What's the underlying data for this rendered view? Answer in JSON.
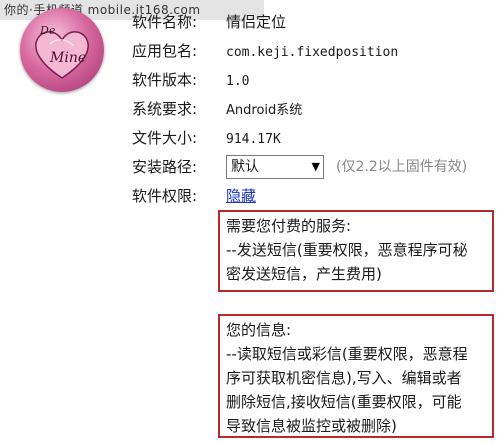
{
  "watermark": "你的·手机频道 mobile.it168.com",
  "icon": {
    "name": "heart-mine-icon",
    "text_top": "De",
    "text_main": "Mine"
  },
  "rows": {
    "name": {
      "label": "软件名称:",
      "value": "情侣定位"
    },
    "package": {
      "label": "应用包名:",
      "value": "com.keji.fixedposition"
    },
    "version": {
      "label": "软件版本:",
      "value": "1.0"
    },
    "requirement": {
      "label": "系统要求:",
      "value": "Android系统"
    },
    "size": {
      "label": "文件大小:",
      "value": "914.17K"
    },
    "install": {
      "label": "安装路径:",
      "selected": "默认",
      "hint": "(仅2.2以上固件有效)"
    },
    "permission": {
      "label": "软件权限:",
      "link": "隐藏"
    }
  },
  "paid_services": {
    "title": "需要您付费的服务:",
    "lines": [
      "--发送短信(重要权限，恶意程序可秘",
      "密发送短信，产生费用)"
    ]
  },
  "info": {
    "title": "您的信息:",
    "lines": [
      "--读取短信或彩信(重要权限，恶意程",
      "序可获取机密信息),写入、编辑或者",
      "删除短信,接收短信(重要权限，可能",
      "导致信息被监控或被删除)"
    ]
  },
  "colors": {
    "box_border": "#b52a2a",
    "link": "#1a33c8",
    "hint": "#888888"
  }
}
